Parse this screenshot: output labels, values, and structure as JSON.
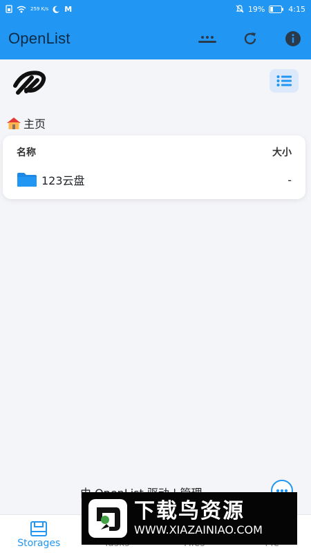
{
  "status": {
    "speed": "259 K/s",
    "carrier_glyph": "M",
    "battery": "19%",
    "time": "4:15"
  },
  "app_bar": {
    "title": "OpenList"
  },
  "breadcrumb": {
    "home": "主页"
  },
  "table": {
    "header_name": "名称",
    "header_size": "大小",
    "rows": [
      {
        "name": "123云盘",
        "size": "-"
      }
    ]
  },
  "footer": {
    "text": "由 OpenList 驱动 | 管理"
  },
  "nav": {
    "items": [
      {
        "label": "Storages"
      },
      {
        "label": "Tasks"
      },
      {
        "label": "Files"
      },
      {
        "label": "Me"
      }
    ]
  },
  "watermark": {
    "title": "下载鸟资源",
    "url": "WWW.XIAZAINIAO.COM"
  },
  "colors": {
    "primary": "#2196f3",
    "folder": "#1e88e5"
  }
}
